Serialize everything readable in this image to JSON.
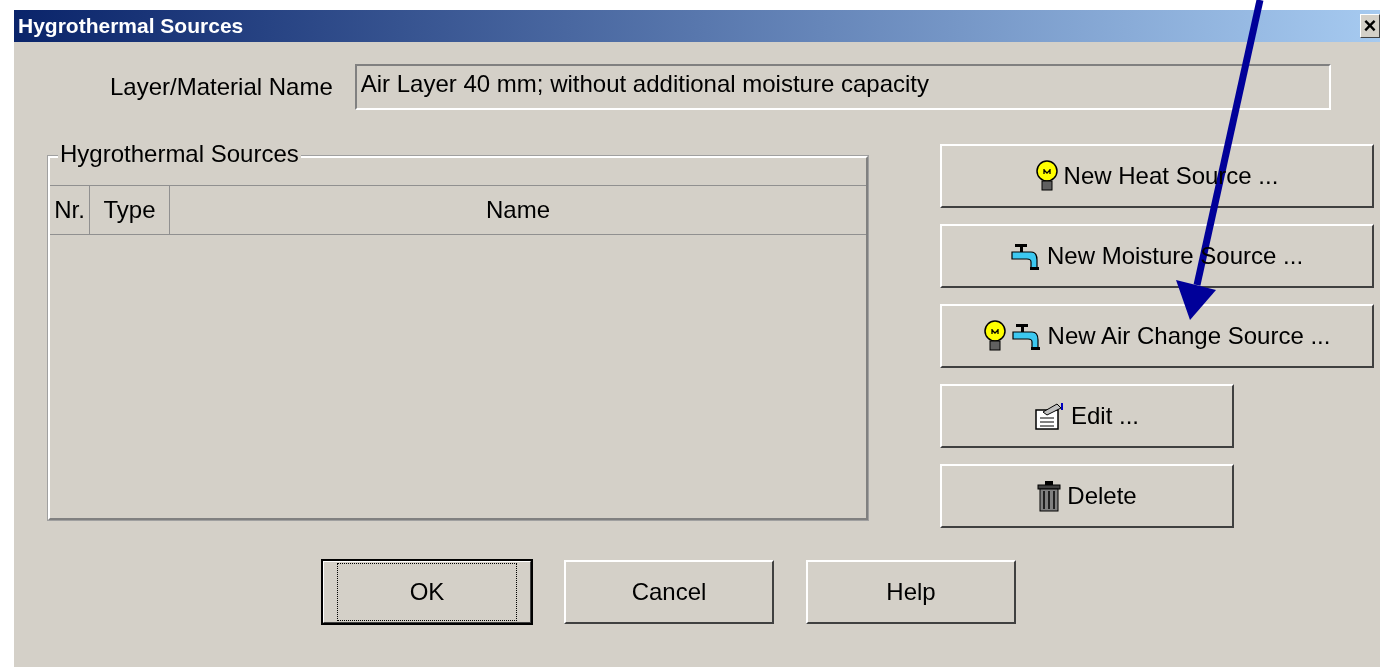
{
  "window": {
    "title": "Hygrothermal Sources",
    "close": "×"
  },
  "name_field": {
    "label": "Layer/Material Name",
    "value": "Air Layer 40 mm; without additional moisture capacity"
  },
  "group": {
    "title": "Hygrothermal Sources",
    "columns": [
      "Nr.",
      "Type",
      "Name"
    ]
  },
  "side_buttons": [
    {
      "label": "New Heat Source ...",
      "icons": [
        {
          "kind": "bulb"
        }
      ],
      "wide": true
    },
    {
      "label": "New Moisture Source ...",
      "icons": [
        {
          "kind": "tap"
        }
      ],
      "wide": true
    },
    {
      "label": "New Air Change Source ...",
      "icons": [
        {
          "kind": "bulb"
        },
        {
          "kind": "tap"
        }
      ],
      "wide": true
    },
    {
      "label": "Edit ...",
      "icons": [
        {
          "kind": "edit"
        }
      ],
      "wide": false
    },
    {
      "label": "Delete",
      "icons": [
        {
          "kind": "trash"
        }
      ],
      "wide": false
    }
  ],
  "buttons": [
    {
      "label": "OK",
      "default": true
    },
    {
      "label": "Cancel",
      "default": false
    },
    {
      "label": "Help",
      "default": false
    }
  ],
  "annotation": {
    "kind": "arrow"
  }
}
